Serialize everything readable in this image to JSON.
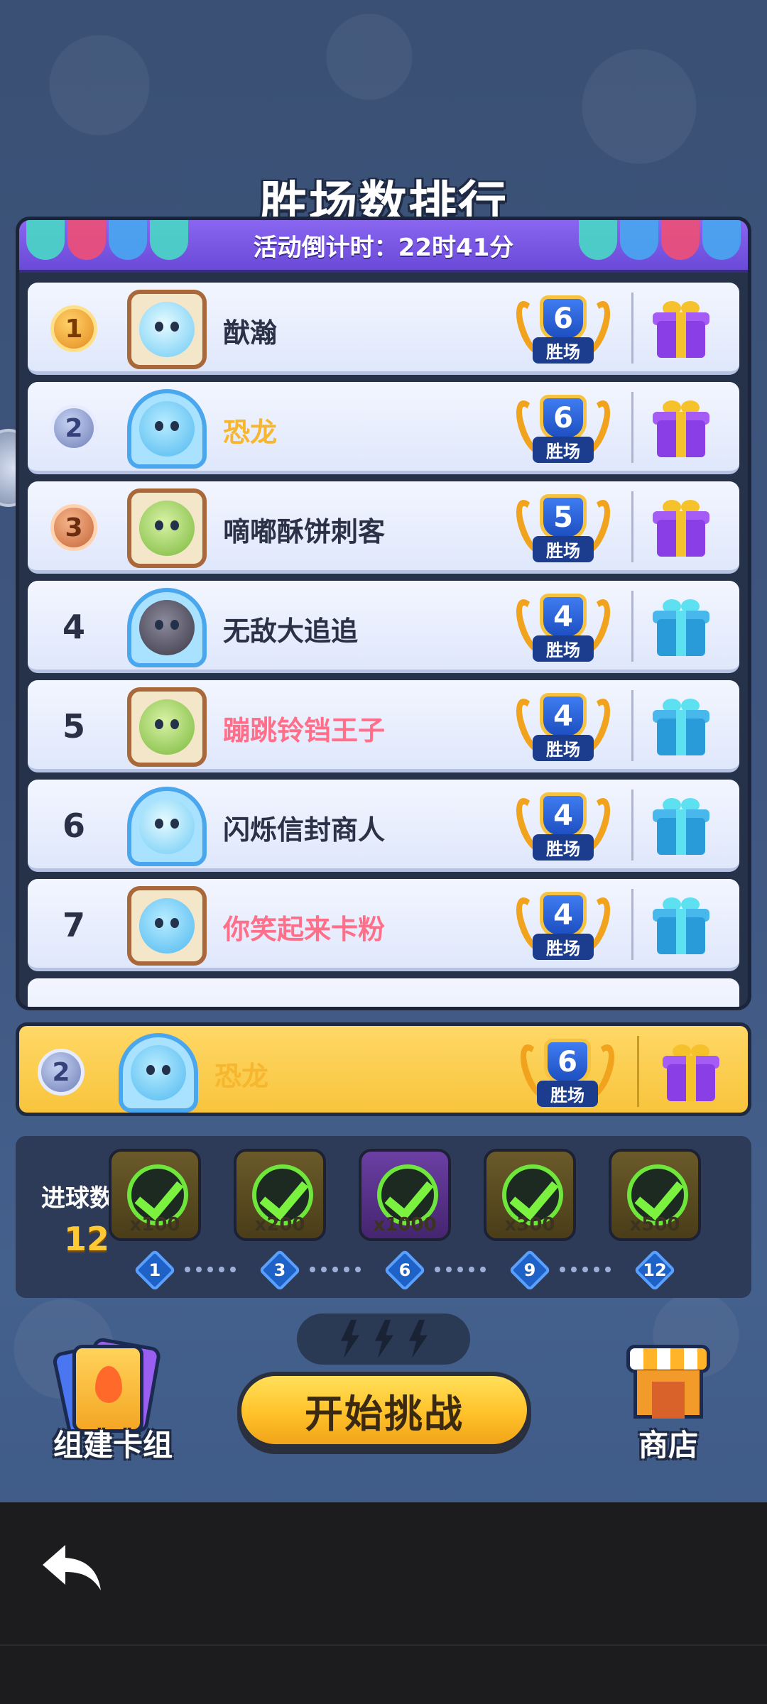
{
  "title": "胜场数排行",
  "banner": {
    "countdown": "活动倒计时：22时41分"
  },
  "rows": [
    {
      "rank": "1",
      "medal": "gold",
      "name": "猷瀚",
      "wins": "6",
      "wins_label": "胜场",
      "name_style": "",
      "avatar": "frame-brown",
      "face": "ice",
      "gift": "purple"
    },
    {
      "rank": "2",
      "medal": "silver",
      "name": "恐龙",
      "wins": "6",
      "wins_label": "胜场",
      "name_style": "gold",
      "avatar": "frame-blue",
      "face": "blob",
      "gift": "purple"
    },
    {
      "rank": "3",
      "medal": "bronze",
      "name": "嘀嘟酥饼刺客",
      "wins": "5",
      "wins_label": "胜场",
      "name_style": "",
      "avatar": "frame-brown",
      "face": "green",
      "gift": "purple"
    },
    {
      "rank": "4",
      "medal": "",
      "name": "无敌大追追",
      "wins": "4",
      "wins_label": "胜场",
      "name_style": "",
      "avatar": "frame-blue",
      "face": "dark",
      "gift": "teal"
    },
    {
      "rank": "5",
      "medal": "",
      "name": "蹦跳铃铛王子",
      "wins": "4",
      "wins_label": "胜场",
      "name_style": "pink",
      "avatar": "frame-brown",
      "face": "green",
      "gift": "teal"
    },
    {
      "rank": "6",
      "medal": "",
      "name": "闪烁信封商人",
      "wins": "4",
      "wins_label": "胜场",
      "name_style": "",
      "avatar": "frame-blue",
      "face": "ice",
      "gift": "teal"
    },
    {
      "rank": "7",
      "medal": "",
      "name": "你笑起来卡粉",
      "wins": "4",
      "wins_label": "胜场",
      "name_style": "pink",
      "avatar": "frame-brown",
      "face": "blob",
      "gift": "teal"
    }
  ],
  "my_row": {
    "rank": "2",
    "name": "恐龙",
    "wins": "6",
    "wins_label": "胜场"
  },
  "goals": {
    "label": "进球数",
    "count": "12",
    "rewards": [
      {
        "amount": "x100",
        "milestone": "1"
      },
      {
        "amount": "x200",
        "milestone": "3"
      },
      {
        "amount": "x1000",
        "milestone": "6"
      },
      {
        "amount": "x300",
        "milestone": "9"
      },
      {
        "amount": "x500",
        "milestone": "12"
      }
    ]
  },
  "buttons": {
    "deck": "组建卡组",
    "start": "开始挑战",
    "shop": "商店"
  },
  "icons": {
    "back": "back-arrow-icon",
    "gift": "gift-icon",
    "energy": "lightning-bolt-icon"
  }
}
